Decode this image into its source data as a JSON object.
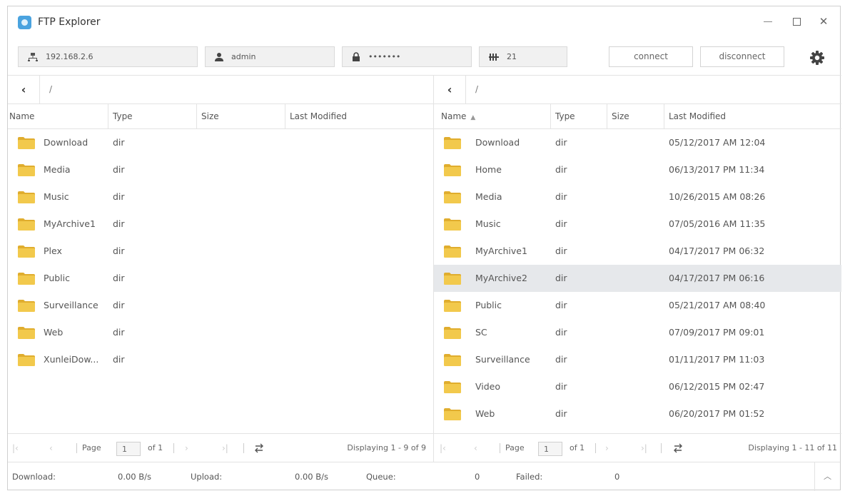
{
  "app": {
    "title": "FTP Explorer"
  },
  "connection": {
    "host": "192.168.2.6",
    "user": "admin",
    "password": "•••••••",
    "port": "21",
    "connect_label": "connect",
    "disconnect_label": "disconnect"
  },
  "columns": {
    "name": "Name",
    "type": "Type",
    "size": "Size",
    "modified": "Last Modified"
  },
  "left": {
    "path": "/",
    "rows": [
      {
        "name": "Download",
        "type": "dir",
        "size": "",
        "modified": ""
      },
      {
        "name": "Media",
        "type": "dir",
        "size": "",
        "modified": ""
      },
      {
        "name": "Music",
        "type": "dir",
        "size": "",
        "modified": ""
      },
      {
        "name": "MyArchive1",
        "type": "dir",
        "size": "",
        "modified": ""
      },
      {
        "name": "Plex",
        "type": "dir",
        "size": "",
        "modified": ""
      },
      {
        "name": "Public",
        "type": "dir",
        "size": "",
        "modified": ""
      },
      {
        "name": "Surveillance",
        "type": "dir",
        "size": "",
        "modified": ""
      },
      {
        "name": "Web",
        "type": "dir",
        "size": "",
        "modified": ""
      },
      {
        "name": "XunleiDow...",
        "type": "dir",
        "size": "",
        "modified": ""
      }
    ],
    "pager": {
      "page_label": "Page",
      "page": "1",
      "of_label": "of 1",
      "display": "Displaying 1 - 9 of 9"
    }
  },
  "right": {
    "path": "/",
    "sort_icon": "▲",
    "selected_index": 5,
    "rows": [
      {
        "name": "Download",
        "type": "dir",
        "size": "",
        "modified": "05/12/2017 AM 12:04"
      },
      {
        "name": "Home",
        "type": "dir",
        "size": "",
        "modified": "06/13/2017 PM 11:34"
      },
      {
        "name": "Media",
        "type": "dir",
        "size": "",
        "modified": "10/26/2015 AM 08:26"
      },
      {
        "name": "Music",
        "type": "dir",
        "size": "",
        "modified": "07/05/2016 AM 11:35"
      },
      {
        "name": "MyArchive1",
        "type": "dir",
        "size": "",
        "modified": "04/17/2017 PM 06:32"
      },
      {
        "name": "MyArchive2",
        "type": "dir",
        "size": "",
        "modified": "04/17/2017 PM 06:16"
      },
      {
        "name": "Public",
        "type": "dir",
        "size": "",
        "modified": "05/21/2017 AM 08:40"
      },
      {
        "name": "SC",
        "type": "dir",
        "size": "",
        "modified": "07/09/2017 PM 09:01"
      },
      {
        "name": "Surveillance",
        "type": "dir",
        "size": "",
        "modified": "01/11/2017 PM 11:03"
      },
      {
        "name": "Video",
        "type": "dir",
        "size": "",
        "modified": "06/12/2015 PM 02:47"
      },
      {
        "name": "Web",
        "type": "dir",
        "size": "",
        "modified": "06/20/2017 PM 01:52"
      }
    ],
    "pager": {
      "page_label": "Page",
      "page": "1",
      "of_label": "of 1",
      "display": "Displaying 1 - 11 of 11"
    }
  },
  "status": {
    "download_label": "Download:",
    "download_value": "0.00 B/s",
    "upload_label": "Upload:",
    "upload_value": "0.00 B/s",
    "queue_label": "Queue:",
    "queue_value": "0",
    "failed_label": "Failed:",
    "failed_value": "0"
  },
  "colors": {
    "folder": "#f2c94c",
    "folder_dark": "#e0ad2e",
    "selection": "#e6e8eb",
    "logo": "#4aa3df"
  }
}
